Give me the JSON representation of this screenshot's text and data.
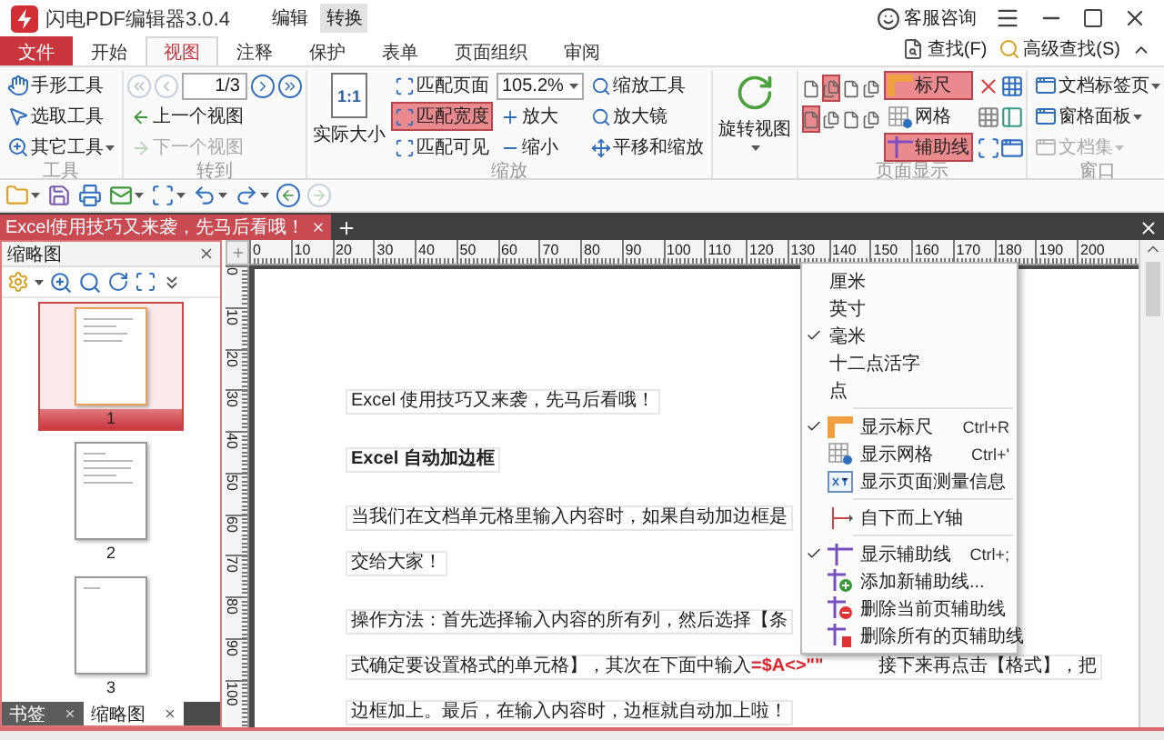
{
  "title_bar": {
    "app_title": "闪电PDF编辑器3.0.4",
    "mode_tabs": [
      {
        "label": "编辑",
        "selected": false
      },
      {
        "label": "转换",
        "selected": true
      }
    ],
    "support": "客服咨询"
  },
  "menu_tabs": [
    {
      "label": "文件",
      "kind": "file",
      "selected": false
    },
    {
      "label": "开始",
      "kind": "tab",
      "selected": false
    },
    {
      "label": "视图",
      "kind": "tab",
      "selected": true
    },
    {
      "label": "注释",
      "kind": "tab",
      "selected": false
    },
    {
      "label": "保护",
      "kind": "tab",
      "selected": false
    },
    {
      "label": "表单",
      "kind": "tab",
      "selected": false
    },
    {
      "label": "页面组织",
      "kind": "tab",
      "selected": false
    },
    {
      "label": "审阅",
      "kind": "tab",
      "selected": false
    }
  ],
  "search_links": [
    "查找(F)",
    "高级查找(S)"
  ],
  "ribbon": {
    "tools": {
      "label": "工具",
      "items": [
        {
          "label": "手形工具",
          "dropdown": false
        },
        {
          "label": "选取工具",
          "dropdown": false
        },
        {
          "label": "其它工具",
          "dropdown": true
        }
      ]
    },
    "goto": {
      "label": "转到",
      "page": "1/3",
      "nav_buttons": [
        {
          "disabled": true
        },
        {
          "disabled": true
        },
        {
          "disabled": false
        },
        {
          "disabled": false
        }
      ],
      "views": [
        {
          "label": "上一个视图",
          "disabled": false
        },
        {
          "label": "下一个视图",
          "disabled": true
        }
      ]
    },
    "zoom": {
      "label": "缩放",
      "actual_size": "实际大小",
      "actual_badge": "1:1",
      "fit": [
        {
          "label": "匹配页面",
          "selected": false
        },
        {
          "label": "匹配宽度",
          "selected": true
        },
        {
          "label": "匹配可见",
          "selected": false
        }
      ],
      "zoom_value": "105.2%",
      "zoom_buttons": [
        "放大",
        "缩小"
      ],
      "tools": [
        "缩放工具",
        "放大镜",
        "平移和缩放"
      ]
    },
    "rotate": {
      "label": "旋转视图"
    },
    "page_display": {
      "label": "页面显示",
      "layouts": [
        {
          "selected": false
        },
        {
          "selected": true
        },
        {
          "selected": false
        },
        {
          "selected": false
        },
        {
          "selected": true
        },
        {
          "selected": false
        },
        {
          "selected": false
        },
        {
          "selected": false
        }
      ],
      "toggles": [
        {
          "label": "标尺",
          "on": true
        },
        {
          "label": "网格",
          "on": false
        },
        {
          "label": "辅助线",
          "on": true
        }
      ]
    },
    "window": {
      "label": "窗口",
      "items": [
        {
          "label": "文档标签页",
          "disabled": false
        },
        {
          "label": "窗格面板",
          "disabled": false
        },
        {
          "label": "文档集",
          "disabled": true
        }
      ]
    }
  },
  "quick_toolbar": {
    "history": [
      {
        "disabled": false
      },
      {
        "disabled": true
      }
    ]
  },
  "doc_tabs": [
    {
      "label": "Excel使用技巧又来袭，先马后看哦！",
      "selected": true
    }
  ],
  "side_panel": {
    "title": "缩略图",
    "thumbnails": [
      {
        "label": "1",
        "selected": true
      },
      {
        "label": "2",
        "selected": false
      },
      {
        "label": "3",
        "selected": false
      }
    ],
    "bottom_tabs": [
      {
        "label": "书签",
        "selected": false
      },
      {
        "label": "缩略图",
        "selected": true
      }
    ]
  },
  "rulers": {
    "horizontal": [
      "0",
      "10",
      "20",
      "30",
      "40",
      "50",
      "60",
      "70",
      "80",
      "90",
      "100",
      "110",
      "120",
      "130",
      "140",
      "150",
      "160",
      "170",
      "180",
      "190",
      "200"
    ],
    "vertical": [
      "0",
      "10",
      "20",
      "30",
      "40",
      "50",
      "60",
      "70",
      "80",
      "90",
      "100"
    ]
  },
  "document": {
    "lines": [
      {
        "kind": "para",
        "text": "Excel 使用技巧又来袭，先马后看哦！"
      },
      {
        "kind": "heading",
        "text": "Excel 自动加边框"
      },
      {
        "kind": "para",
        "text": "当我们在文档单元格里输入内容时，如果自动加边框是"
      },
      {
        "kind": "cont",
        "text": "交给大家！"
      },
      {
        "kind": "para",
        "text": "操作方法：首先选择输入内容的所有列，然后选择【条"
      },
      {
        "kind": "cont",
        "text": "式确定要设置格式的单元格】，其次在下面中输入",
        "formula": "=$A<>\"\"",
        "tail": "接下来再点击【格式】，把"
      },
      {
        "kind": "cont",
        "text": "边框加上。最后，在输入内容时，边框就自动加上啦！"
      }
    ]
  },
  "context_menu": {
    "items": [
      {
        "kind": "unit",
        "label": "厘米",
        "checked": false
      },
      {
        "kind": "unit",
        "label": "英寸",
        "checked": false
      },
      {
        "kind": "unit",
        "label": "毫米",
        "checked": true
      },
      {
        "kind": "unit",
        "label": "十二点活字",
        "checked": false
      },
      {
        "kind": "unit",
        "label": "点",
        "checked": false
      },
      {
        "kind": "separator"
      },
      {
        "kind": "command",
        "label": "显示标尺",
        "shortcut": "Ctrl+R",
        "checked": true
      },
      {
        "kind": "command",
        "label": "显示网格",
        "shortcut": "Ctrl+'",
        "checked": false
      },
      {
        "kind": "command",
        "label": "显示页面测量信息",
        "checked": false
      },
      {
        "kind": "separator"
      },
      {
        "kind": "command",
        "label": "自下而上Y轴",
        "checked": false
      },
      {
        "kind": "separator"
      },
      {
        "kind": "command",
        "label": "显示辅助线",
        "shortcut": "Ctrl+;",
        "checked": true
      },
      {
        "kind": "command",
        "label": "添加新辅助线...",
        "checked": false
      },
      {
        "kind": "command",
        "label": "删除当前页辅助线",
        "checked": false
      },
      {
        "kind": "command",
        "label": "删除所有的页辅助线",
        "checked": false
      }
    ]
  }
}
